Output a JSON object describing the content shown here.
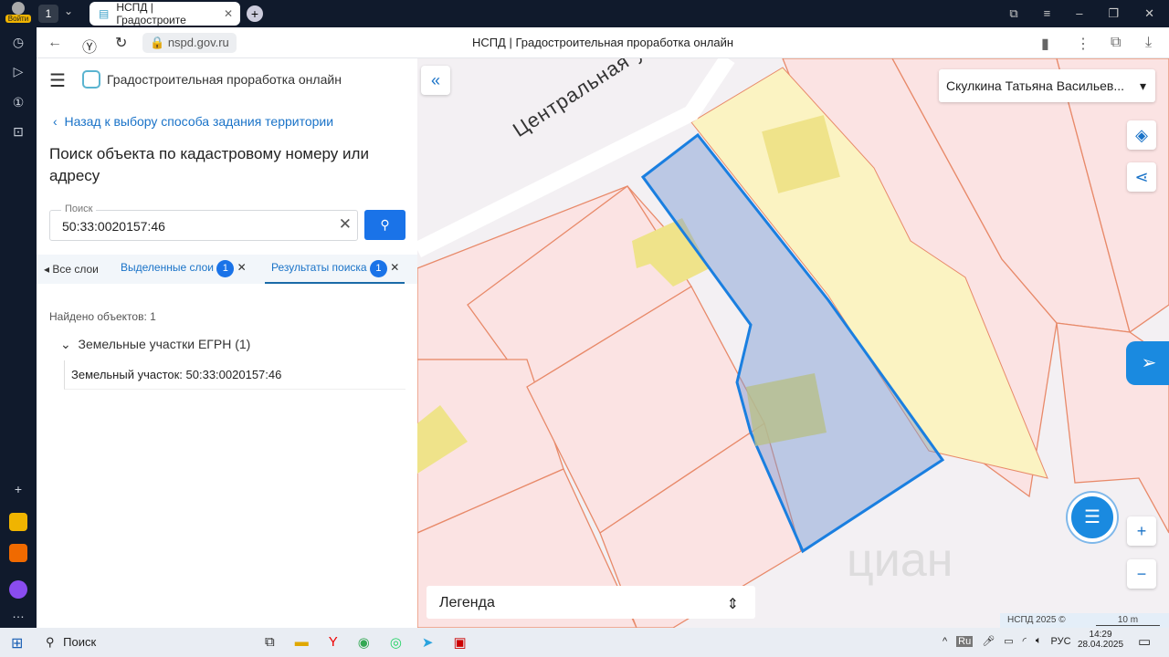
{
  "browser": {
    "login_label": "Войти",
    "tab_count": "1",
    "tab_title": "НСПД | Градостроите",
    "url": "nspd.gov.ru",
    "page_title": "НСПД | Градостроительная проработка онлайн"
  },
  "app": {
    "title": "Градостроительная проработка онлайн",
    "back_link": "Назад к выбору способа задания территории",
    "heading": "Поиск объекта по кадастровому номеру или адресу",
    "search": {
      "label": "Поиск",
      "value": "50:33:0020157:46"
    },
    "tabs": [
      {
        "label": "Все слои"
      },
      {
        "label": "Выделенные слои",
        "count": "1"
      },
      {
        "label": "Результаты поиска",
        "count": "1",
        "active": true
      }
    ],
    "found": "Найдено объектов: 1",
    "group": "Земельные участки ЕГРН (1)",
    "result": "Земельный участок: 50:33:0020157:46"
  },
  "map": {
    "user": "Скулкина Татьяна Васильев...",
    "street": "Центральная ул",
    "legend": "Легенда",
    "copyright": "НСПД 2025 ©",
    "scale": "10 m",
    "watermark": "циан",
    "selection_color": "#1a7fe0"
  },
  "taskbar": {
    "search": "Поиск",
    "lang_badge": "Ru",
    "lang": "РУС",
    "time": "14:29",
    "date": "28.04.2025"
  }
}
